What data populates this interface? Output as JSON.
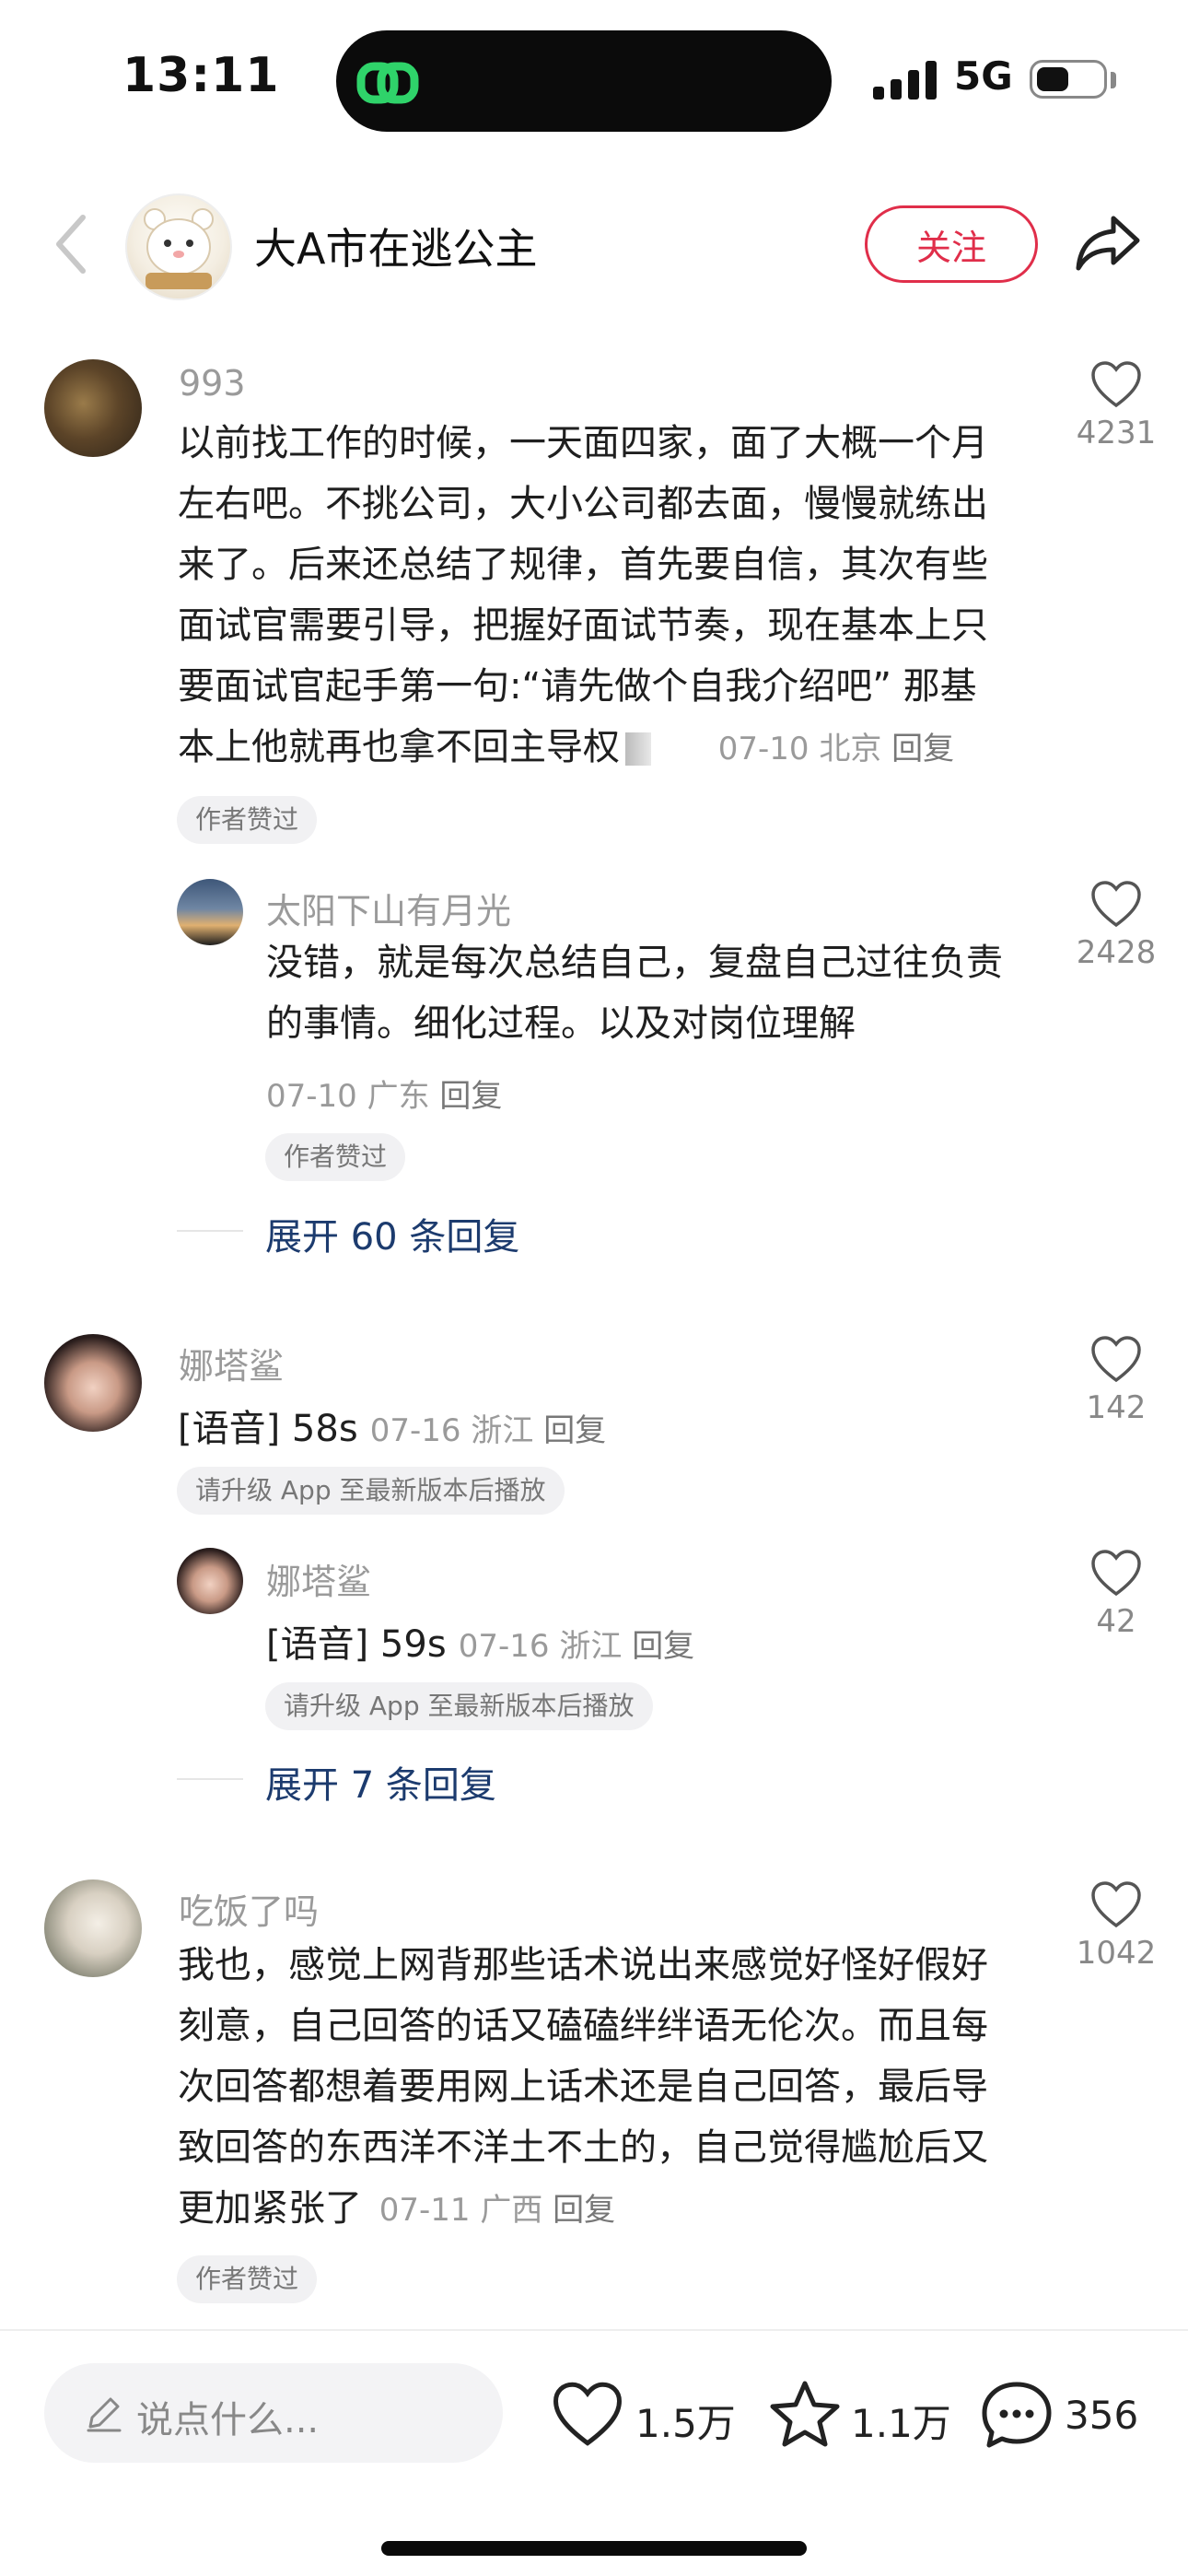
{
  "status_bar": {
    "time": "13:11",
    "network": "5G"
  },
  "header": {
    "title": "大A市在逃公主",
    "follow_label": "关注"
  },
  "comments": [
    {
      "username": "993",
      "text_lines": [
        "以前找工作的时候，一天面四家，面了大概一个月",
        "左右吧。不挑公司，大小公司都去面，慢慢就练出",
        "来了。后来还总结了规律，首先要自信，其次有些",
        "面试官需要引导，把握好面试节奏，现在基本上只",
        "要面试官起手第一句:“请先做个自我介绍吧” 那基",
        "本上他就再也拿不回主导权"
      ],
      "date": "07-10",
      "location": "北京",
      "reply_label": "回复",
      "likes": "4231",
      "badge": "作者赞过",
      "reply": {
        "username": "太阳下山有月光",
        "text_lines": [
          "没错，就是每次总结自己，复盘自己过往负责",
          "的事情。细化过程。以及对岗位理解"
        ],
        "date": "07-10",
        "location": "广东",
        "reply_label": "回复",
        "likes": "2428",
        "badge": "作者赞过"
      },
      "expand_label": "展开 60 条回复"
    },
    {
      "username": "娜塔鲨",
      "voice": "[语音] 58s",
      "date": "07-16",
      "location": "浙江",
      "reply_label": "回复",
      "likes": "142",
      "badge": "请升级 App 至最新版本后播放",
      "reply": {
        "username": "娜塔鲨",
        "voice": "[语音] 59s",
        "date": "07-16",
        "location": "浙江",
        "reply_label": "回复",
        "likes": "42",
        "badge": "请升级 App 至最新版本后播放"
      },
      "expand_label": "展开 7 条回复"
    },
    {
      "username": "吃饭了吗",
      "text_lines": [
        "我也，感觉上网背那些话术说出来感觉好怪好假好",
        "刻意，自己回答的话又磕磕绊绊语无伦次。而且每",
        "次回答都想着要用网上话术还是自己回答，最后导",
        "致回答的东西洋不洋土不土的，自己觉得尴尬后又",
        "更加紧张了"
      ],
      "date": "07-11",
      "location": "广西",
      "reply_label": "回复",
      "likes": "1042",
      "badge": "作者赞过"
    }
  ],
  "bottom_bar": {
    "input_placeholder": "说点什么...",
    "like_count": "1.5万",
    "star_count": "1.1万",
    "comment_count": "356"
  },
  "colors": {
    "accent": "#e02e4a",
    "link": "#1c3b6e"
  },
  "icons": [
    "back-icon",
    "share-icon",
    "heart-icon",
    "star-icon",
    "comment-icon",
    "pencil-icon",
    "island-app-icon"
  ]
}
